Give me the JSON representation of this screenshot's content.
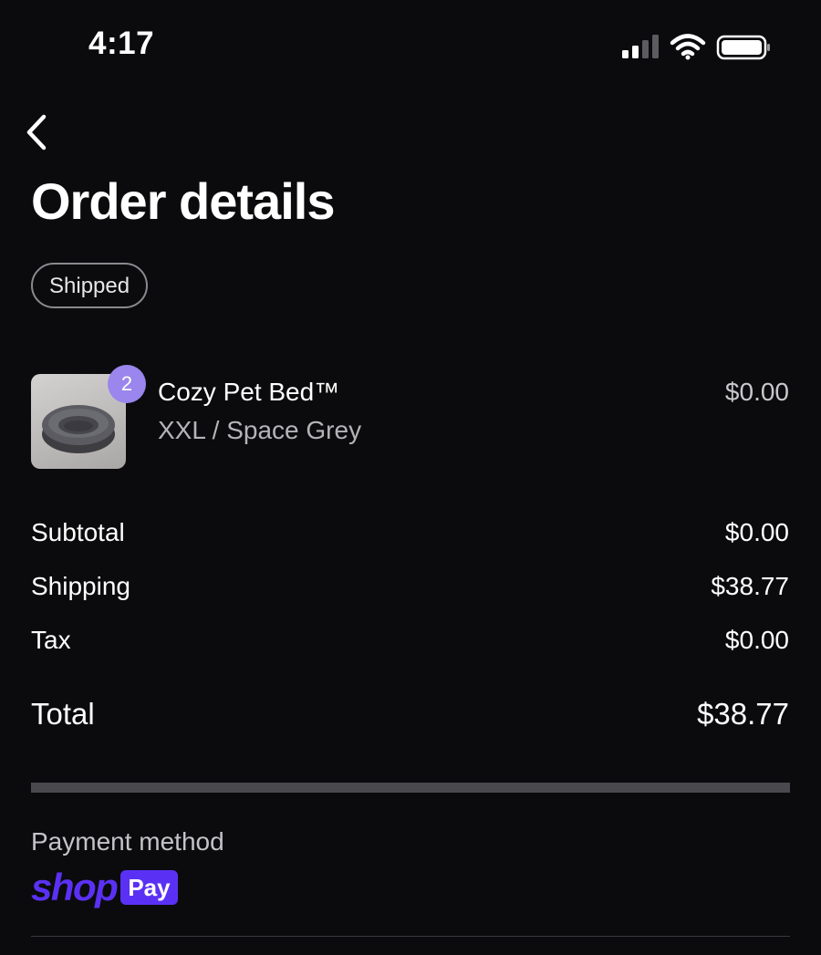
{
  "status_bar": {
    "time": "4:17",
    "icons": [
      "cellular-signal-icon",
      "wifi-icon",
      "battery-icon"
    ]
  },
  "header": {
    "back_icon": "chevron-left-icon",
    "title": "Order details",
    "status_badge": "Shipped"
  },
  "line_items": [
    {
      "name": "Cozy Pet Bed™",
      "variant": "XXL / Space Grey",
      "price": "$0.00",
      "quantity": "2",
      "image": "pet-bed-thumbnail"
    }
  ],
  "summary": {
    "subtotal_label": "Subtotal",
    "subtotal_value": "$0.00",
    "shipping_label": "Shipping",
    "shipping_value": "$38.77",
    "tax_label": "Tax",
    "tax_value": "$0.00",
    "total_label": "Total",
    "total_value": "$38.77"
  },
  "payment": {
    "label": "Payment method",
    "logo_text": "shop",
    "logo_badge": "Pay"
  },
  "colors": {
    "background": "#0b0b0d",
    "accent": "#5a31f4",
    "quantity_badge": "#9a86ec"
  }
}
